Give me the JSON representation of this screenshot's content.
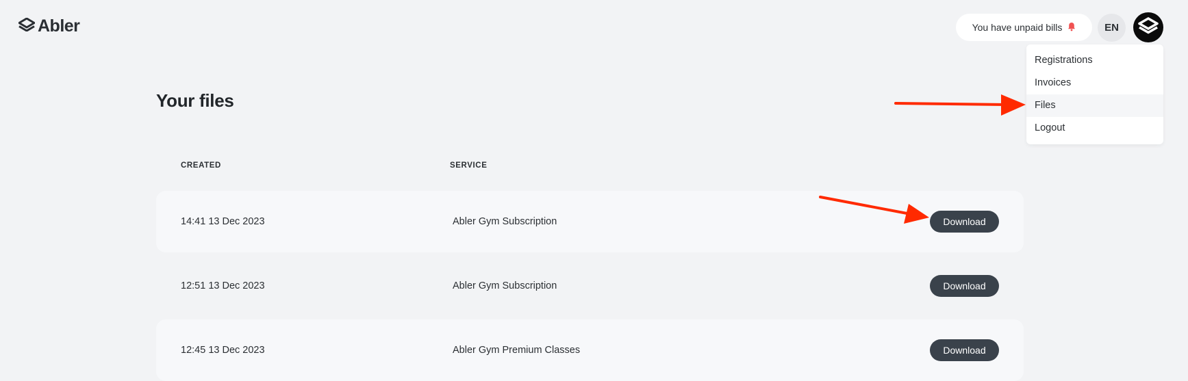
{
  "header": {
    "logo_text": "Abler",
    "unpaid_bills": "You have unpaid bills",
    "language": "EN"
  },
  "menu": {
    "items": [
      {
        "label": "Registrations"
      },
      {
        "label": "Invoices"
      },
      {
        "label": "Files"
      },
      {
        "label": "Logout"
      }
    ]
  },
  "main": {
    "title": "Your files",
    "columns": {
      "created": "CREATED",
      "service": "SERVICE"
    },
    "rows": [
      {
        "created": "14:41 13 Dec 2023",
        "service": "Abler Gym Subscription",
        "action": "Download"
      },
      {
        "created": "12:51 13 Dec 2023",
        "service": "Abler Gym Subscription",
        "action": "Download"
      },
      {
        "created": "12:45 13 Dec 2023",
        "service": "Abler Gym Premium Classes",
        "action": "Download"
      }
    ]
  },
  "colors": {
    "background": "#f2f3f5",
    "button": "#3a424b",
    "annotation_arrow": "#ff2a00",
    "bell": "#f05252"
  },
  "icons": [
    "abler-logo-icon",
    "bell-icon",
    "avatar-logo-icon"
  ]
}
